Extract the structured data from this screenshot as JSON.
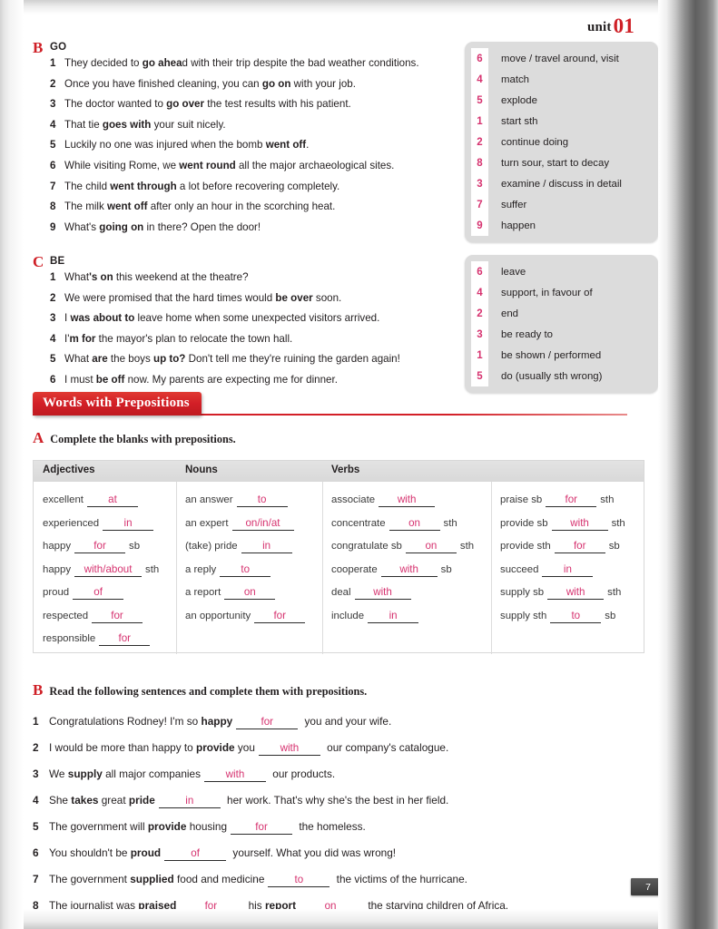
{
  "header": {
    "unit_label": "unit",
    "unit_number": "01"
  },
  "exercise_go": {
    "letter": "B",
    "title": "GO",
    "sentences": [
      {
        "n": "1",
        "pre": "They decided to ",
        "bold": "go ahea",
        "post": "d with their trip despite the bad weather conditions."
      },
      {
        "n": "2",
        "pre": "Once you have finished cleaning, you can ",
        "bold": "go on",
        "post": " with your  job."
      },
      {
        "n": "3",
        "pre": "The doctor wanted to ",
        "bold": "go over",
        "post": " the test results with his patient."
      },
      {
        "n": "4",
        "pre": "That tie ",
        "bold": "goes with",
        "post": " your suit nicely."
      },
      {
        "n": "5",
        "pre": "Luckily no one was injured when the bomb ",
        "bold": "went off",
        "post": "."
      },
      {
        "n": "6",
        "pre": "While visiting Rome, we ",
        "bold": "went round",
        "post": " all the major archaeological sites."
      },
      {
        "n": "7",
        "pre": "The child ",
        "bold": "went through",
        "post": " a lot before recovering completely."
      },
      {
        "n": "8",
        "pre": "The milk ",
        "bold": "went off",
        "post": " after only an hour in the scorching heat."
      },
      {
        "n": "9",
        "pre": "What's ",
        "bold": "going on",
        "post": " in there? Open the door!"
      }
    ],
    "key": [
      {
        "n": "6",
        "t": "move / travel around, visit"
      },
      {
        "n": "4",
        "t": "match"
      },
      {
        "n": "5",
        "t": "explode"
      },
      {
        "n": "1",
        "t": "start sth"
      },
      {
        "n": "2",
        "t": "continue doing"
      },
      {
        "n": "8",
        "t": "turn sour, start to decay"
      },
      {
        "n": "3",
        "t": "examine / discuss in detail"
      },
      {
        "n": "7",
        "t": "suffer"
      },
      {
        "n": "9",
        "t": "happen"
      }
    ]
  },
  "exercise_be": {
    "letter": "C",
    "title": "BE",
    "sentences": [
      {
        "n": "1",
        "pre": "What",
        "bold": "'s on",
        "post": " this weekend at the theatre?"
      },
      {
        "n": "2",
        "pre": "We were promised that the hard times would ",
        "bold": "be over",
        "post": " soon."
      },
      {
        "n": "3",
        "pre": "I ",
        "bold": "was about to",
        "post": " leave home when some unexpected visitors arrived."
      },
      {
        "n": "4",
        "pre": "I'",
        "bold": "m for",
        "post": " the mayor's plan to relocate the town hall."
      },
      {
        "n": "5",
        "pre": "What ",
        "bold": "are",
        "post": " the boys ",
        "bold2": "up to?",
        "post2": " Don't tell me they're ruining the garden again!"
      },
      {
        "n": "6",
        "pre": "I must ",
        "bold": "be off",
        "post": " now. My parents are expecting me for dinner."
      }
    ],
    "key": [
      {
        "n": "6",
        "t": "leave"
      },
      {
        "n": "4",
        "t": "support, in favour of"
      },
      {
        "n": "2",
        "t": "end"
      },
      {
        "n": "3",
        "t": "be ready to"
      },
      {
        "n": "1",
        "t": "be shown / performed"
      },
      {
        "n": "5",
        "t": "do  (usually sth wrong)"
      }
    ]
  },
  "section": {
    "banner": "Words with Prepositions"
  },
  "task_a": {
    "letter": "A",
    "text_bold": "Complete the blanks with ",
    "text_light": "prepositions.",
    "headers": [
      "Adjectives",
      "Nouns",
      "Verbs"
    ],
    "columns": [
      [
        {
          "pre": "excellent",
          "ans": "at",
          "post": ""
        },
        {
          "pre": "experienced",
          "ans": "in",
          "post": ""
        },
        {
          "pre": "happy",
          "ans": "for",
          "post": "sb"
        },
        {
          "pre": "happy",
          "ans": "with/about",
          "post": "sth"
        },
        {
          "pre": "proud",
          "ans": "of",
          "post": ""
        },
        {
          "pre": "respected",
          "ans": "for",
          "post": ""
        },
        {
          "pre": "responsible",
          "ans": "for",
          "post": ""
        }
      ],
      [
        {
          "pre": "an answer",
          "ans": "to",
          "post": ""
        },
        {
          "pre": "an expert",
          "ans": "on/in/at",
          "post": ""
        },
        {
          "pre": "(take) pride",
          "ans": "in",
          "post": ""
        },
        {
          "pre": "a reply",
          "ans": "to",
          "post": ""
        },
        {
          "pre": "a report",
          "ans": "on",
          "post": ""
        },
        {
          "pre": "an opportunity",
          "ans": "for",
          "post": ""
        }
      ],
      [
        {
          "pre": "associate",
          "ans": "with",
          "post": ""
        },
        {
          "pre": "concentrate",
          "ans": "on",
          "post": "sth"
        },
        {
          "pre": "congratulate sb",
          "ans": "on",
          "post": "sth"
        },
        {
          "pre": "cooperate",
          "ans": "with",
          "post": "sb"
        },
        {
          "pre": "deal",
          "ans": "with",
          "post": ""
        },
        {
          "pre": "include",
          "ans": "in",
          "post": ""
        }
      ],
      [
        {
          "pre": "praise sb",
          "ans": "for",
          "post": "sth"
        },
        {
          "pre": "provide sb",
          "ans": "with",
          "post": "sth"
        },
        {
          "pre": "provide sth",
          "ans": "for",
          "post": "sb"
        },
        {
          "pre": "succeed",
          "ans": "in",
          "post": ""
        },
        {
          "pre": "supply sb",
          "ans": "with",
          "post": "sth"
        },
        {
          "pre": "supply sth",
          "ans": "to",
          "post": "sb"
        }
      ]
    ]
  },
  "task_b": {
    "letter": "B",
    "text_bold": "Read the following sentences and complete them with ",
    "text_light": "prepositions.",
    "sentences": [
      {
        "n": "1",
        "p1": "Congratulations Rodney! I'm so ",
        "b1": "happy",
        "ans": "for",
        "p2": " you and your wife."
      },
      {
        "n": "2",
        "p1": "I would be more than happy to ",
        "b1": "provide",
        "p1b": " you",
        "ans": "with",
        "p2": " our company's catalogue."
      },
      {
        "n": "3",
        "p1": "We ",
        "b1": "supply",
        "p1b": " all major companies",
        "ans": "with",
        "p2": " our products."
      },
      {
        "n": "4",
        "p1": "She ",
        "b1": "takes",
        "p1b": " great ",
        "b2": "pride",
        "ans": "in",
        "p2": " her work. That's why she's the best in her field."
      },
      {
        "n": "5",
        "p1": "The government will ",
        "b1": "provide",
        "p1b": " housing",
        "ans": "for",
        "p2": " the homeless."
      },
      {
        "n": "6",
        "p1": "You shouldn't be ",
        "b1": "proud",
        "ans": "of",
        "p2": " yourself. What you did was wrong!"
      },
      {
        "n": "7",
        "p1": "The government ",
        "b1": "supplied",
        "p1b": " food and medicine",
        "ans": "to",
        "p2": " the victims of the hurricane."
      },
      {
        "n": "8",
        "p1": "The journalist was ",
        "b1": "praised",
        "ans": "for",
        "p2": " his ",
        "b2": "report",
        "ans2": "on",
        "p3": " the starving children of Africa."
      }
    ]
  },
  "footer": {
    "page_number": "7"
  },
  "colors": {
    "accent_red": "#cf2027",
    "handwriting": "#d6326f",
    "key_panel": "#dcdcdc"
  }
}
